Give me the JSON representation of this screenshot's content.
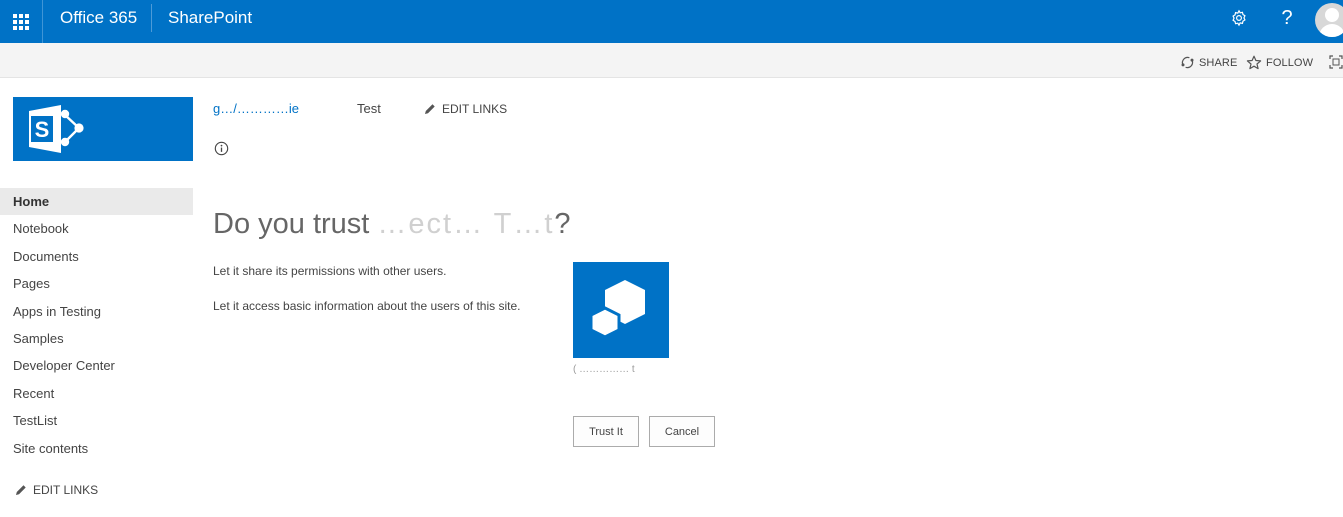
{
  "suite_bar": {
    "brand": "Office 365",
    "app_name": "SharePoint",
    "help_glyph": "?",
    "icons": [
      "app-launcher-icon",
      "gear-icon",
      "help-icon",
      "avatar"
    ],
    "color": "#0072c6"
  },
  "ribbon": {
    "share_label": "SHARE",
    "follow_label": "FOLLOW"
  },
  "top_nav": {
    "site_link": "g…/…………ie",
    "test_link": "Test",
    "edit_links": "EDIT LINKS"
  },
  "left_nav": {
    "items": [
      {
        "label": "Home",
        "selected": true
      },
      {
        "label": "Notebook"
      },
      {
        "label": "Documents"
      },
      {
        "label": "Pages"
      },
      {
        "label": "Apps in Testing"
      },
      {
        "label": "Samples"
      },
      {
        "label": "Developer Center"
      },
      {
        "label": "Recent"
      },
      {
        "label": "TestList"
      },
      {
        "label": "Site contents"
      }
    ],
    "edit_links": "EDIT LINKS"
  },
  "trust": {
    "title_prefix": "Do you trust",
    "title_masked": "…ect…  T…t",
    "title_suffix": "?",
    "permissions": [
      "Let it share its permissions with other users.",
      "Let it access basic information about the users of this site."
    ],
    "app_caption": "( …………… t",
    "trust_button": "Trust It",
    "cancel_button": "Cancel"
  }
}
